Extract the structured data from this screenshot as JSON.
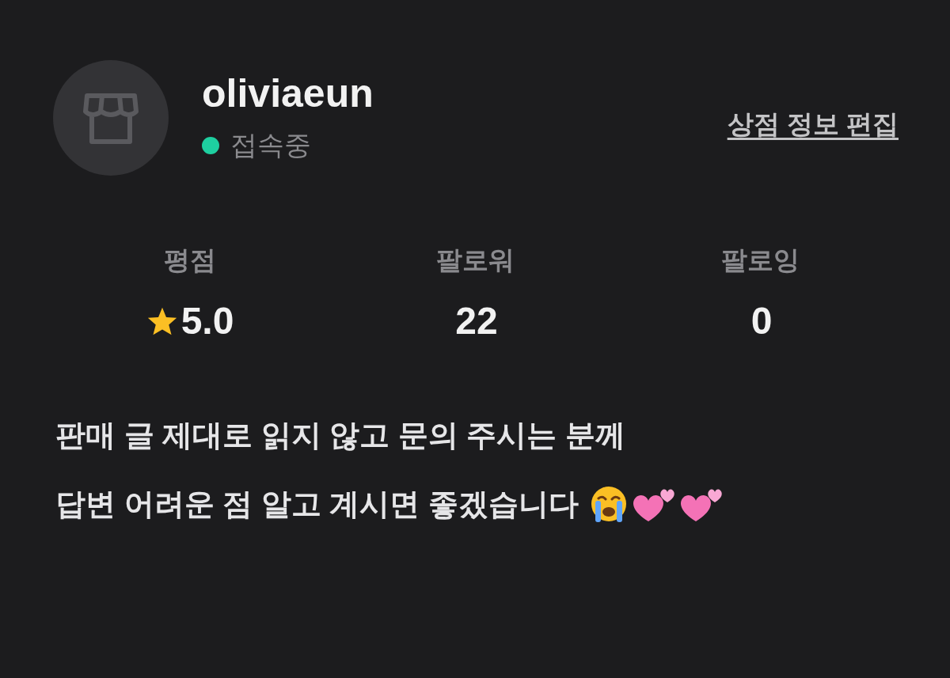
{
  "profile": {
    "username": "oliviaeun",
    "online": true,
    "status": "접속중",
    "edit_link": "상점 정보 편집"
  },
  "stats": [
    {
      "kind": "rating",
      "label": "평점",
      "value": "5.0"
    },
    {
      "kind": "count",
      "label": "팔로워",
      "value": "22"
    },
    {
      "kind": "count",
      "label": "팔로잉",
      "value": "0"
    }
  ],
  "bio": [
    "판매 글 제대로 읽지 않고 문의 주시는 분께",
    "답변 어려운 점 알고 계시면 좋겠습니다"
  ]
}
